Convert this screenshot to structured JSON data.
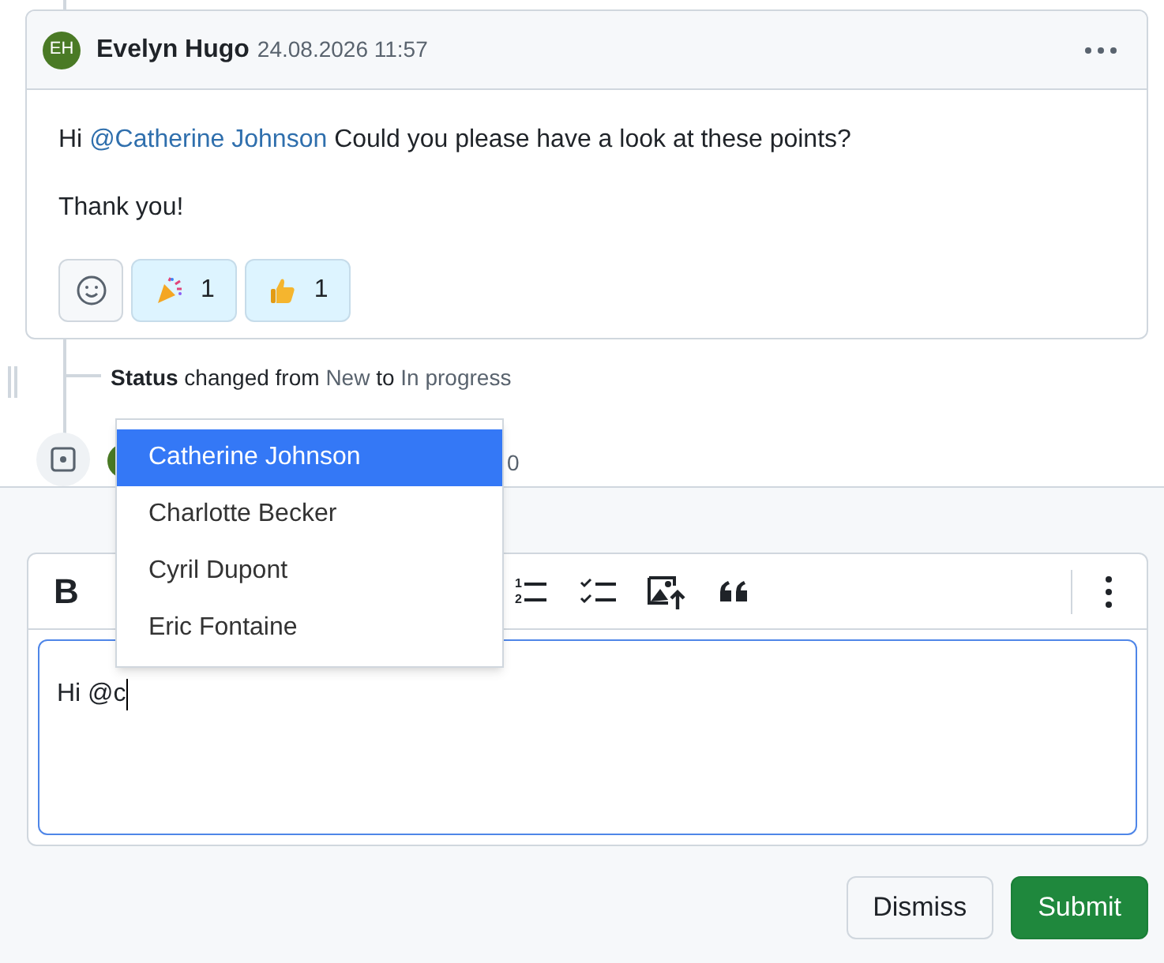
{
  "comment": {
    "avatar_initials": "EH",
    "author": "Evelyn Hugo",
    "timestamp": "24.08.2026 11:57",
    "body_lines": [
      [
        {
          "kind": "plain",
          "text": "Hi "
        },
        {
          "kind": "mention",
          "text": "@Catherine Johnson"
        },
        {
          "kind": "plain",
          "text": " Could you please have a look at these points?"
        }
      ],
      [
        {
          "kind": "plain",
          "text": "Thank you!"
        }
      ]
    ],
    "reactions": [
      {
        "kind": "add"
      },
      {
        "kind": "party",
        "count": "1"
      },
      {
        "kind": "thumbs",
        "count": "1"
      }
    ]
  },
  "status_event": {
    "field": "Status",
    "middle": "changed from",
    "from": "New",
    "joiner": "to",
    "to": "In progress"
  },
  "next_event_tail": "0",
  "mention_menu": [
    {
      "label": "Catherine Johnson",
      "selected": true
    },
    {
      "label": "Charlotte Becker",
      "selected": false
    },
    {
      "label": "Cyril Dupont",
      "selected": false
    },
    {
      "label": "Eric Fontaine",
      "selected": false
    }
  ],
  "toolbar": [
    {
      "kind": "bold",
      "label": "B"
    },
    {
      "kind": "numbered-list",
      "digits": [
        "1",
        "2"
      ]
    },
    {
      "kind": "task-list"
    },
    {
      "kind": "image"
    },
    {
      "kind": "quote"
    }
  ],
  "editor": {
    "value": "Hi @c"
  },
  "buttons": [
    {
      "kind": "secondary",
      "label": "Dismiss"
    },
    {
      "kind": "primary",
      "label": "Submit"
    }
  ]
}
